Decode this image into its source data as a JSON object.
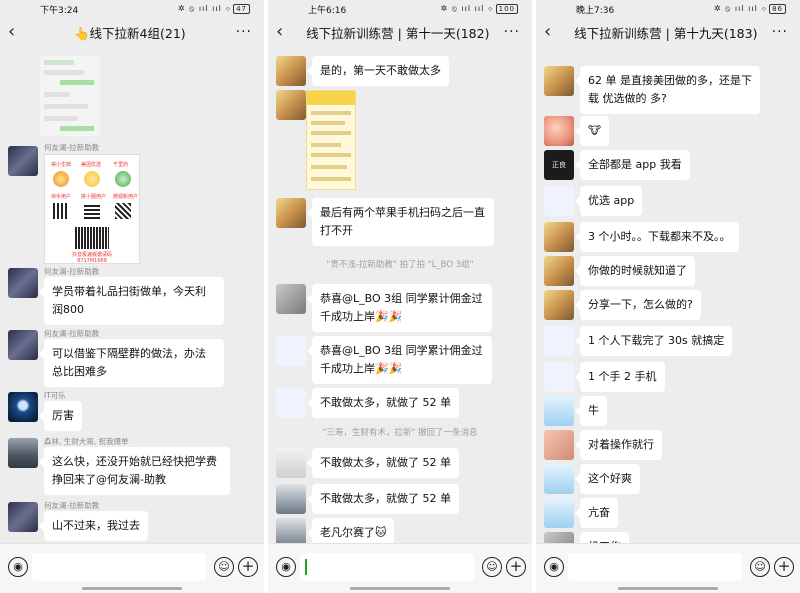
{
  "panels": [
    {
      "status_time": "下午3:24",
      "status_icons": "✲ ⦸ ııl ııl ⌔",
      "battery": "47",
      "title": "👆线下拉新4组(21)",
      "messages": [
        {
          "name": "",
          "text": ""
        },
        {
          "name": "何友澜-拉新助教",
          "text": ""
        },
        {
          "name": "何友澜-拉新助教",
          "text": "学员带着礼品扫街做单，今天利润800"
        },
        {
          "name": "何友澜-拉新助教",
          "text": "可以借鉴下隔壁群的做法，办法总比困难多"
        },
        {
          "name": "IT可乐",
          "text": "厉害"
        },
        {
          "name": "森林, 生财大哥, 祝我爆单",
          "text": "这么快，还没开始就已经快把学费挣回来了@何友澜-助教"
        },
        {
          "name": "何友澜-拉新助教",
          "text": "山不过来，我过去"
        }
      ],
      "poster": {
        "labels": [
          "得小生鲜",
          "美团优选",
          "千里药",
          "快手用户",
          "拼小圈用户",
          "微视新用户"
        ],
        "footer1": "抖音极速版邀请码",
        "footer2": "8717M1668"
      }
    },
    {
      "status_time": "上午6:16",
      "status_icons": "✲ ⦸ ııl ııl ⌔",
      "battery": "100",
      "title": "线下拉新训练营 | 第十一天(182)",
      "messages": [
        {
          "text": "是的，第一天不敢做太多"
        },
        {
          "text": ""
        },
        {
          "text": "最后有两个苹果手机扫码之后一直打不开"
        },
        {
          "system": "\"贵不浅-拉新助教\" 拍了拍 \"L_BO 3组\""
        },
        {
          "text": "恭喜@L_BO 3组  同学累计佣金过千成功上岸🎉🎉"
        },
        {
          "text": "恭喜@L_BO 3组  同学累计佣金过千成功上岸🎉🎉"
        },
        {
          "text": "不敢做太多，就做了 52 单"
        },
        {
          "system": "\"三寿，生财有术，拉新\" 撤回了一条消息"
        },
        {
          "text": "不敢做太多，就做了 52 单"
        },
        {
          "text": "不敢做太多，就做了 52 单"
        },
        {
          "text": "老凡尔赛了🐱"
        }
      ]
    },
    {
      "status_time": "晚上7:36",
      "status_icons": "✲ ⦸ ııl ııl ⌔",
      "battery": "86",
      "title": "线下拉新训练营 | 第十九天(183)",
      "messages": [
        {
          "text": "62 单 是直接美团做的多，还是下载 优选做的 多?"
        },
        {
          "text": "🐮"
        },
        {
          "text": "全部都是 app 我看"
        },
        {
          "text": "优选 app"
        },
        {
          "text": "3 个小时。。下载都来不及。。"
        },
        {
          "text": "你做的时候就知道了"
        },
        {
          "text": "分享一下，怎么做的?"
        },
        {
          "text": "1 个人下载完了 30s 就搞定"
        },
        {
          "text": "1 个手 2 手机"
        },
        {
          "text": "牛"
        },
        {
          "text": "对着操作就行"
        },
        {
          "text": "这个好爽"
        },
        {
          "text": "亢奋"
        },
        {
          "text": "机工作"
        }
      ],
      "avatar_label": "正良"
    }
  ],
  "icons": {
    "back": "‹",
    "more": "···",
    "voice": "◉",
    "emoji": "☺",
    "plus": "+"
  }
}
